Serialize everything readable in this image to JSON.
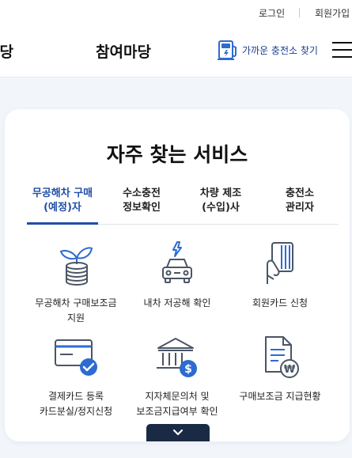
{
  "util": {
    "login": "로그인",
    "signup": "회원가입"
  },
  "gnb": {
    "menu_partial": "마당",
    "menu_participation": "참여마당",
    "charger_search": "가까운 충전소 찾기"
  },
  "services_section": {
    "title": "자주 찾는 서비스",
    "tabs": [
      {
        "label": "무공해차 구매\n(예정)자",
        "active": true
      },
      {
        "label": "수소충전\n정보확인",
        "active": false
      },
      {
        "label": "차량 제조\n(수입)사",
        "active": false
      },
      {
        "label": "충전소\n관리자",
        "active": false
      }
    ],
    "items": [
      {
        "label": "무공해차 구매보조금\n지원",
        "icon": "coin-stack-plant-icon"
      },
      {
        "label": "내차 저공해 확인",
        "icon": "electric-car-icon"
      },
      {
        "label": "회원카드 신청",
        "icon": "hand-card-icon"
      },
      {
        "label": "결제카드 등록\n카드분실/정지신청",
        "icon": "card-check-icon"
      },
      {
        "label": "지자체문의처 및\n보조금지급여부 확인",
        "icon": "bank-coin-icon"
      },
      {
        "label": "구매보조금 지급현황",
        "icon": "document-won-icon"
      }
    ]
  },
  "colors": {
    "accent": "#1f4fa8",
    "icon_dark": "#4b5566",
    "icon_blue": "#2e6bd0",
    "more_button": "#1b2a44"
  }
}
